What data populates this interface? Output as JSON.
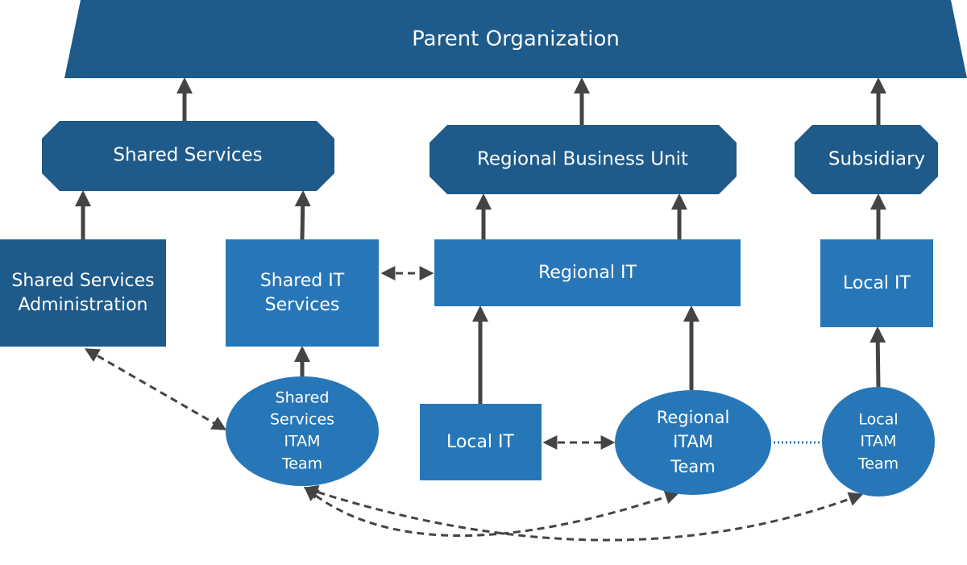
{
  "colors": {
    "dark": "#1e5a8a",
    "light": "#2777b8",
    "arrow": "#444444"
  },
  "nodes": {
    "parent": "Parent Organization",
    "shared_services": "Shared Services",
    "regional_bu": "Regional Business Unit",
    "subsidiary": "Subsidiary",
    "ss_admin": [
      "Shared Services",
      "Administration"
    ],
    "shared_it": [
      "Shared IT",
      "Services"
    ],
    "regional_it": "Regional IT",
    "local_it_sub": "Local IT",
    "local_it_reg": "Local IT",
    "ss_itam": [
      "Shared",
      "Services",
      "ITAM",
      "Team"
    ],
    "regional_itam": [
      "Regional",
      "ITAM",
      "Team"
    ],
    "local_itam": [
      "Local",
      "ITAM",
      "Team"
    ]
  }
}
